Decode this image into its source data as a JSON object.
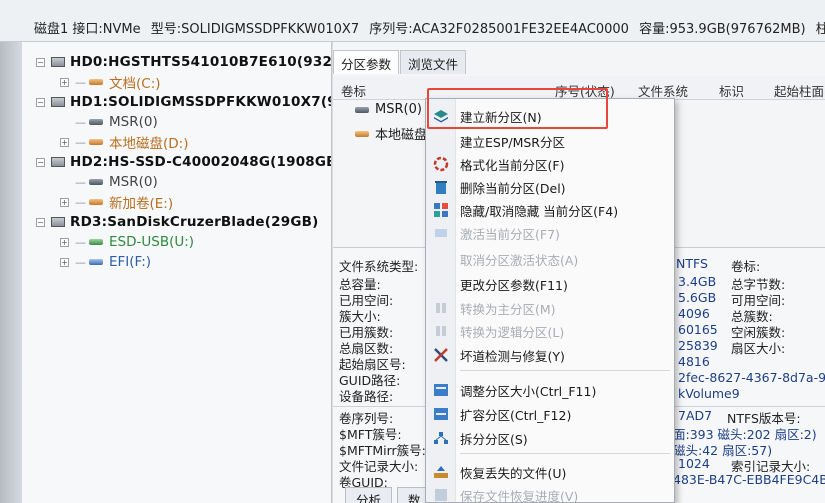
{
  "infobar": {
    "disk": "磁盘1 接口:NVMe",
    "model": "型号:SOLIDIGMSSDPFKKW010X7",
    "serial": "序列号:ACA32F0285001FE32EE4AC0000",
    "capacity": "容量:953.9GB(976762MB)",
    "cyl": "柱面"
  },
  "tree": {
    "hd0": "HD0:HGSTHTS541010B7E610(932G",
    "hd0_p1": "文档(C:)",
    "hd1": "HD1:SOLIDIGMSSDPFKKW010X7(9",
    "hd1_p1": "MSR(0)",
    "hd1_p2": "本地磁盘(D:)",
    "hd2": "HD2:HS-SSD-C40002048G(1908GB)",
    "hd2_p1": "MSR(0)",
    "hd2_p2": "新加卷(E:)",
    "rd3": "RD3:SanDiskCruzerBlade(29GB)",
    "rd3_p1": "ESD-USB(U:)",
    "rd3_p2": "EFI(F:)"
  },
  "tabs": [
    "分区参数",
    "浏览文件"
  ],
  "list": {
    "col_label": "卷标",
    "col_seq": "序号(状态)",
    "col_fs": "文件系统",
    "col_id": "标识",
    "col_start": "起始柱面",
    "rows": [
      "MSR(0)",
      "本地磁盘"
    ]
  },
  "details": {
    "fs_type_label": "文件系统类型:",
    "fs_type_value": "NTFS",
    "vol_label": "卷标:",
    "left_labels": [
      "总容量:",
      "已用空间:",
      "簇大小:",
      "已用簇数:",
      "总扇区数:",
      "起始扇区号:",
      "GUID路径:",
      "设备路径:"
    ],
    "mid_values": [
      "3.4GB",
      "5.6GB",
      "4096",
      "60165",
      "25839",
      "4816",
      "2fec-8627-4367-8d7a-9",
      "kVolume9"
    ],
    "right_labels": [
      "总字节数:",
      "可用空间:",
      "总簇数:",
      "空闲簇数:",
      "扇区大小:"
    ],
    "left_labels2": [
      "卷序列号:",
      "$MFT簇号:",
      "$MFTMirr簇号:",
      "文件记录大小:",
      "卷GUID:"
    ],
    "mid_values2": [
      "7AD7",
      "面:393 磁头:202 扇区:2)",
      "磁头:42 扇区:57)",
      "1024",
      "483E-B47C-EBB4FE9C4B"
    ],
    "right_labels2": [
      "NTFS版本号:",
      "",
      "",
      "索引记录大小:",
      ""
    ],
    "analyze_tab": "分析",
    "data_tab": "数"
  },
  "menu": {
    "items": [
      {
        "label": "建立新分区(N)",
        "icon": "layers-icon",
        "disabled": false
      },
      {
        "label": "建立ESP/MSR分区",
        "icon": "none",
        "disabled": false
      },
      {
        "label": "格式化当前分区(F)",
        "icon": "format-icon",
        "disabled": false
      },
      {
        "label": "删除当前分区(Del)",
        "icon": "trash-icon",
        "disabled": false
      },
      {
        "label": "隐藏/取消隐藏 当前分区(F4)",
        "icon": "hide-icon",
        "disabled": false
      },
      {
        "label": "激活当前分区(F7)",
        "icon": "activate-icon",
        "disabled": true
      },
      {
        "label": "取消分区激活状态(A)",
        "icon": "none",
        "disabled": true
      },
      {
        "label": "更改分区参数(F11)",
        "icon": "none",
        "disabled": false
      },
      {
        "label": "转换为主分区(M)",
        "icon": "convert-icon",
        "disabled": true
      },
      {
        "label": "转换为逻辑分区(L)",
        "icon": "convert-icon",
        "disabled": true
      },
      {
        "label": "坏道检测与修复(Y)",
        "icon": "tools-icon",
        "disabled": false
      },
      {
        "label": "调整分区大小(Ctrl_F11)",
        "icon": "resize-icon",
        "disabled": false
      },
      {
        "label": "扩容分区(Ctrl_F12)",
        "icon": "expand-icon",
        "disabled": false
      },
      {
        "label": "拆分分区(S)",
        "icon": "split-icon",
        "disabled": false
      },
      {
        "label": "恢复丢失的文件(U)",
        "icon": "recover-icon",
        "disabled": false
      },
      {
        "label": "保存文件恢复进度(V)",
        "icon": "save-icon",
        "disabled": true
      }
    ]
  },
  "colors": {
    "highlight": "#e8463b",
    "accent_blue": "#1e3f86"
  }
}
